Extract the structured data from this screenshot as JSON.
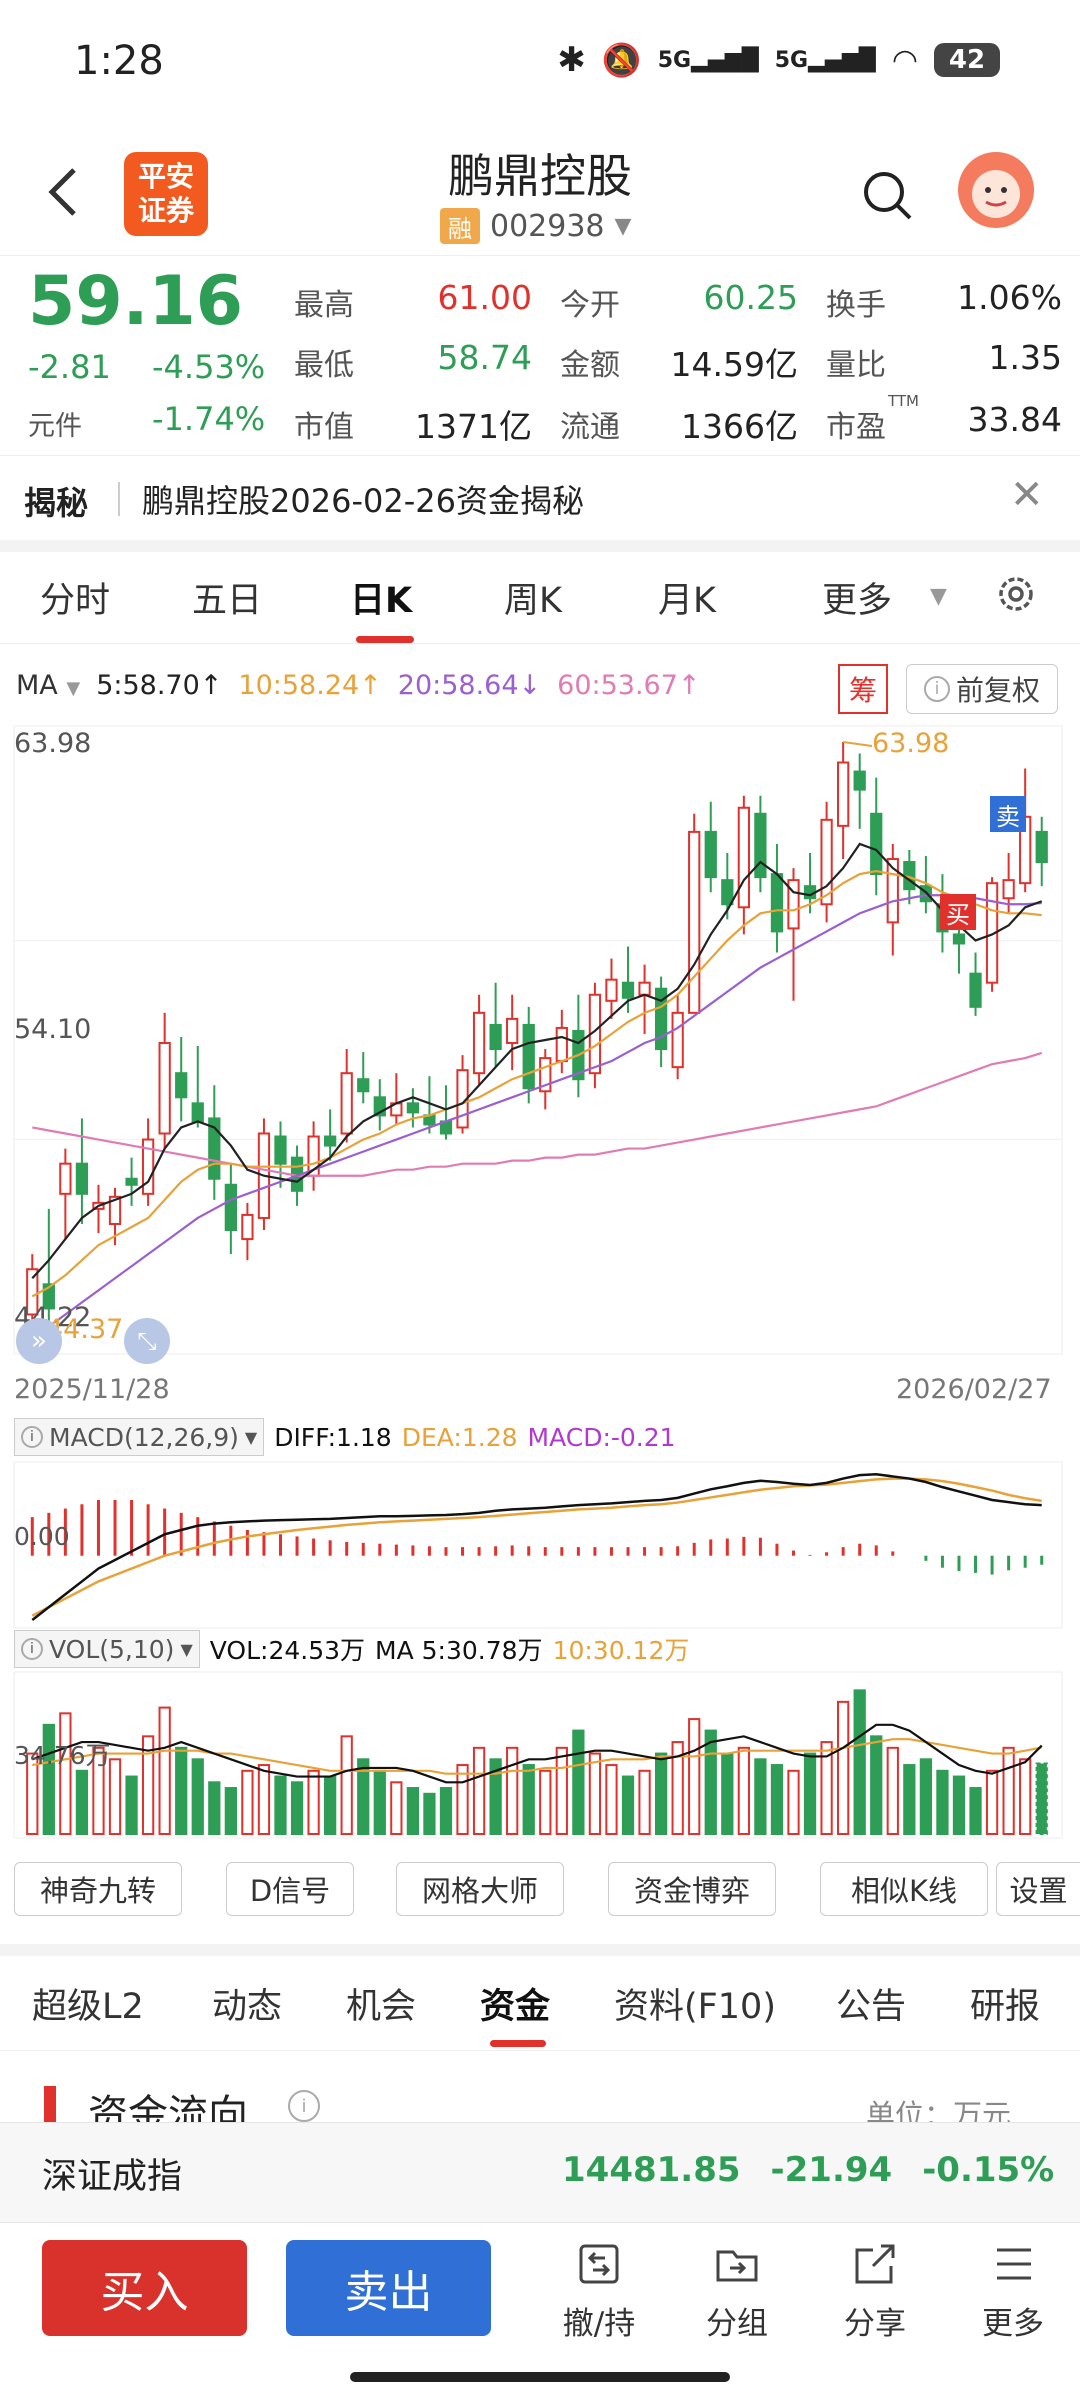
{
  "status": {
    "time": "1:28",
    "net1": "5G",
    "net2": "5G",
    "battery": "42"
  },
  "header": {
    "broker_logo": "平安\n证券",
    "stock_name": "鹏鼎控股",
    "rong_badge": "融",
    "stock_code": "002938"
  },
  "quote": {
    "price": "59.16",
    "change": "-2.81",
    "change_pct": "-4.53%",
    "unit_label": "元件",
    "sector_pct": "-1.74%",
    "fields": [
      {
        "label": "最高",
        "value": "61.00",
        "color": "#e0312c"
      },
      {
        "label": "最低",
        "value": "58.74",
        "color": "#2e9d55"
      },
      {
        "label": "市值",
        "value": "1371亿",
        "color": "#222222"
      },
      {
        "label": "今开",
        "value": "60.25",
        "color": "#2e9d55"
      },
      {
        "label": "金额",
        "value": "14.59亿",
        "color": "#222222"
      },
      {
        "label": "流通",
        "value": "1366亿",
        "color": "#222222"
      },
      {
        "label": "换手",
        "value": "1.06%",
        "color": "#222222"
      },
      {
        "label": "量比",
        "value": "1.35",
        "color": "#222222"
      },
      {
        "label": "市盈",
        "value": "33.84",
        "color": "#222222"
      }
    ],
    "ttm": "TTM"
  },
  "reveal": {
    "tag": "揭秘",
    "text": "鹏鼎控股2026-02-26资金揭秘"
  },
  "period_tabs": [
    "分时",
    "五日",
    "日K",
    "周K",
    "月K",
    "更多"
  ],
  "ma": {
    "label": "MA",
    "ma5": "5:58.70↑",
    "ma10": "10:58.24↑",
    "ma20": "20:58.64↓",
    "ma60": "60:53.67↑",
    "chip_label": "筹",
    "fq_label": "前复权"
  },
  "kline": {
    "y_top": "63.98",
    "y_mid": "54.10",
    "y_bottom": "44.22",
    "high_marker": "63.98",
    "low_marker": "44.37",
    "date_start": "2025/11/28",
    "date_end": "2026/02/27",
    "sell_tag": "卖",
    "buy_tag": "买"
  },
  "macd": {
    "label": "MACD(12,26,9)",
    "diff": "DIFF:1.18",
    "dea": "DEA:1.28",
    "macd": "MACD:-0.21",
    "axis": "0.00"
  },
  "vol": {
    "label": "VOL(5,10)",
    "vol": "VOL:24.53万",
    "ma5": "MA 5:30.78万",
    "ma10": "10:30.12万",
    "axis": "34.76万"
  },
  "tools": [
    "神奇九转",
    "D信号",
    "网格大师",
    "资金博弈",
    "相似K线",
    "设置"
  ],
  "section_tabs": [
    "超级L2",
    "动态",
    "机会",
    "资金",
    "资料(F10)",
    "公告",
    "研报"
  ],
  "flow": {
    "title": "资金流向",
    "unit": "单位：万元"
  },
  "index": {
    "name": "深证成指",
    "value": "14481.85",
    "change": "-21.94",
    "pct": "-0.15%"
  },
  "bottom": {
    "buy": "买入",
    "sell": "卖出",
    "items": [
      "撤/持",
      "分组",
      "分享",
      "更多"
    ]
  },
  "chart_data": {
    "type": "candlestick",
    "title": "",
    "x_range": [
      "2025/11/28",
      "2026/02/27"
    ],
    "ylim": [
      44.22,
      63.98
    ],
    "y_ticks": [
      63.98,
      54.1,
      44.22
    ],
    "candles": [
      {
        "o": 45.0,
        "h": 47.0,
        "l": 44.5,
        "c": 46.5
      },
      {
        "o": 46.0,
        "h": 48.5,
        "l": 44.4,
        "c": 45.2
      },
      {
        "o": 49.0,
        "h": 50.5,
        "l": 47.5,
        "c": 50.0
      },
      {
        "o": 50.0,
        "h": 51.5,
        "l": 48.0,
        "c": 49.0
      },
      {
        "o": 48.5,
        "h": 49.3,
        "l": 47.7,
        "c": 48.7
      },
      {
        "o": 48.0,
        "h": 49.2,
        "l": 47.3,
        "c": 48.9
      },
      {
        "o": 49.5,
        "h": 50.2,
        "l": 48.6,
        "c": 49.3
      },
      {
        "o": 49.0,
        "h": 51.5,
        "l": 48.6,
        "c": 50.8
      },
      {
        "o": 51.0,
        "h": 55.0,
        "l": 50.5,
        "c": 54.0
      },
      {
        "o": 53.0,
        "h": 54.2,
        "l": 51.4,
        "c": 52.2
      },
      {
        "o": 52.0,
        "h": 53.9,
        "l": 51.2,
        "c": 51.4
      },
      {
        "o": 51.5,
        "h": 52.6,
        "l": 48.8,
        "c": 49.5
      },
      {
        "o": 49.3,
        "h": 50.0,
        "l": 47.0,
        "c": 47.8
      },
      {
        "o": 47.5,
        "h": 48.7,
        "l": 46.8,
        "c": 48.3
      },
      {
        "o": 48.2,
        "h": 51.5,
        "l": 47.8,
        "c": 51.0
      },
      {
        "o": 50.9,
        "h": 51.4,
        "l": 49.2,
        "c": 50.0
      },
      {
        "o": 50.2,
        "h": 50.6,
        "l": 48.6,
        "c": 49.1
      },
      {
        "o": 49.6,
        "h": 51.4,
        "l": 49.1,
        "c": 50.9
      },
      {
        "o": 50.9,
        "h": 51.8,
        "l": 50.1,
        "c": 50.6
      },
      {
        "o": 51.0,
        "h": 53.8,
        "l": 50.7,
        "c": 53.0
      },
      {
        "o": 52.8,
        "h": 53.7,
        "l": 52.0,
        "c": 52.4
      },
      {
        "o": 52.2,
        "h": 52.8,
        "l": 51.1,
        "c": 51.6
      },
      {
        "o": 51.6,
        "h": 53.0,
        "l": 51.3,
        "c": 52.0
      },
      {
        "o": 52.0,
        "h": 52.5,
        "l": 51.2,
        "c": 51.7
      },
      {
        "o": 51.6,
        "h": 52.9,
        "l": 51.0,
        "c": 51.3
      },
      {
        "o": 51.4,
        "h": 52.6,
        "l": 50.8,
        "c": 51.0
      },
      {
        "o": 51.2,
        "h": 53.6,
        "l": 51.0,
        "c": 53.1
      },
      {
        "o": 53.0,
        "h": 55.6,
        "l": 52.6,
        "c": 55.0
      },
      {
        "o": 54.6,
        "h": 56.0,
        "l": 53.2,
        "c": 53.8
      },
      {
        "o": 54.0,
        "h": 55.6,
        "l": 53.1,
        "c": 54.8
      },
      {
        "o": 54.6,
        "h": 55.2,
        "l": 52.0,
        "c": 52.5
      },
      {
        "o": 52.4,
        "h": 53.8,
        "l": 51.8,
        "c": 53.5
      },
      {
        "o": 53.4,
        "h": 55.1,
        "l": 53.0,
        "c": 54.5
      },
      {
        "o": 54.4,
        "h": 55.6,
        "l": 52.2,
        "c": 52.8
      },
      {
        "o": 53.0,
        "h": 56.0,
        "l": 52.5,
        "c": 55.6
      },
      {
        "o": 55.4,
        "h": 56.8,
        "l": 54.8,
        "c": 56.1
      },
      {
        "o": 56.0,
        "h": 57.2,
        "l": 55.0,
        "c": 55.5
      },
      {
        "o": 55.6,
        "h": 56.6,
        "l": 54.3,
        "c": 56.0
      },
      {
        "o": 55.8,
        "h": 56.2,
        "l": 53.2,
        "c": 53.8
      },
      {
        "o": 53.2,
        "h": 55.6,
        "l": 52.8,
        "c": 55.0
      },
      {
        "o": 55.0,
        "h": 61.6,
        "l": 55.0,
        "c": 61.0
      },
      {
        "o": 61.0,
        "h": 62.0,
        "l": 59.0,
        "c": 59.5
      },
      {
        "o": 59.4,
        "h": 60.3,
        "l": 58.1,
        "c": 58.6
      },
      {
        "o": 58.5,
        "h": 62.2,
        "l": 57.6,
        "c": 61.8
      },
      {
        "o": 61.6,
        "h": 62.2,
        "l": 59.0,
        "c": 59.5
      },
      {
        "o": 59.6,
        "h": 60.6,
        "l": 57.0,
        "c": 57.7
      },
      {
        "o": 57.8,
        "h": 59.8,
        "l": 55.4,
        "c": 59.4
      },
      {
        "o": 59.2,
        "h": 60.3,
        "l": 58.3,
        "c": 58.8
      },
      {
        "o": 58.6,
        "h": 62.0,
        "l": 58.0,
        "c": 61.4
      },
      {
        "o": 61.2,
        "h": 63.98,
        "l": 60.1,
        "c": 63.3
      },
      {
        "o": 63.0,
        "h": 63.6,
        "l": 61.1,
        "c": 62.4
      },
      {
        "o": 61.6,
        "h": 62.8,
        "l": 58.9,
        "c": 59.6
      },
      {
        "o": 58.0,
        "h": 60.6,
        "l": 56.9,
        "c": 60.1
      },
      {
        "o": 60.0,
        "h": 60.4,
        "l": 58.6,
        "c": 59.1
      },
      {
        "o": 59.2,
        "h": 60.2,
        "l": 58.3,
        "c": 58.7
      },
      {
        "o": 58.6,
        "h": 59.6,
        "l": 57.0,
        "c": 57.7
      },
      {
        "o": 57.6,
        "h": 58.4,
        "l": 56.3,
        "c": 57.3
      },
      {
        "o": 56.3,
        "h": 57.0,
        "l": 54.9,
        "c": 55.2
      },
      {
        "o": 56.0,
        "h": 59.5,
        "l": 55.7,
        "c": 59.3
      },
      {
        "o": 58.8,
        "h": 60.3,
        "l": 58.3,
        "c": 59.4
      },
      {
        "o": 59.3,
        "h": 63.1,
        "l": 59.0,
        "c": 61.5
      },
      {
        "o": 61.0,
        "h": 61.5,
        "l": 59.2,
        "c": 60.0
      }
    ],
    "ma5": [
      46.2,
      46.8,
      47.5,
      48.2,
      48.6,
      48.8,
      49.0,
      49.4,
      50.5,
      51.2,
      51.4,
      51.2,
      50.6,
      49.8,
      49.6,
      49.5,
      49.4,
      49.8,
      50.2,
      50.9,
      51.4,
      51.7,
      52.0,
      52.2,
      52.0,
      51.8,
      52.0,
      52.6,
      53.2,
      53.8,
      54.0,
      54.1,
      54.2,
      54.0,
      54.4,
      54.9,
      55.4,
      55.6,
      55.4,
      55.8,
      56.6,
      57.6,
      58.4,
      59.4,
      60.0,
      59.6,
      59.0,
      58.9,
      59.2,
      59.8,
      60.6,
      60.4,
      59.8,
      59.4,
      59.0,
      58.4,
      57.9,
      57.4,
      57.6,
      57.9,
      58.5,
      58.7
    ],
    "ma10": [
      45.6,
      45.9,
      46.3,
      46.8,
      47.3,
      47.6,
      47.9,
      48.2,
      48.8,
      49.4,
      49.8,
      50.0,
      50.0,
      49.9,
      49.9,
      49.9,
      49.9,
      50.0,
      50.2,
      50.5,
      50.8,
      51.0,
      51.3,
      51.5,
      51.6,
      51.8,
      52.0,
      52.2,
      52.5,
      52.8,
      53.0,
      53.2,
      53.4,
      53.6,
      53.9,
      54.3,
      54.7,
      55.0,
      55.2,
      55.6,
      56.2,
      56.8,
      57.4,
      57.9,
      58.3,
      58.4,
      58.4,
      58.6,
      58.9,
      59.3,
      59.6,
      59.7,
      59.6,
      59.5,
      59.3,
      59.0,
      58.8,
      58.6,
      58.4,
      58.3,
      58.3,
      58.24
    ],
    "ma20": [
      44.2,
      44.6,
      45.0,
      45.4,
      45.8,
      46.2,
      46.6,
      47.0,
      47.4,
      47.8,
      48.2,
      48.5,
      48.8,
      49.0,
      49.2,
      49.4,
      49.6,
      49.8,
      50.0,
      50.2,
      50.4,
      50.6,
      50.8,
      51.0,
      51.2,
      51.4,
      51.6,
      51.8,
      52.0,
      52.2,
      52.4,
      52.6,
      52.8,
      53.0,
      53.2,
      53.4,
      53.7,
      54.0,
      54.2,
      54.5,
      54.9,
      55.3,
      55.7,
      56.1,
      56.5,
      56.8,
      57.1,
      57.4,
      57.7,
      58.0,
      58.3,
      58.5,
      58.7,
      58.8,
      58.9,
      58.9,
      58.9,
      58.8,
      58.7,
      58.6,
      58.6,
      58.64
    ],
    "ma60": [
      51.2,
      51.1,
      51.0,
      50.9,
      50.8,
      50.7,
      50.6,
      50.5,
      50.4,
      50.3,
      50.2,
      50.1,
      50.0,
      49.9,
      49.8,
      49.7,
      49.6,
      49.6,
      49.6,
      49.6,
      49.6,
      49.7,
      49.8,
      49.8,
      49.9,
      49.9,
      50.0,
      50.0,
      50.0,
      50.1,
      50.1,
      50.2,
      50.2,
      50.3,
      50.3,
      50.4,
      50.5,
      50.5,
      50.6,
      50.7,
      50.8,
      50.9,
      51.0,
      51.1,
      51.2,
      51.3,
      51.4,
      51.5,
      51.6,
      51.7,
      51.8,
      51.9,
      52.1,
      52.3,
      52.5,
      52.7,
      52.9,
      53.1,
      53.3,
      53.4,
      53.5,
      53.67
    ],
    "macd_range": [
      -1.5,
      2.0
    ],
    "diff": [
      -1.5,
      -1.2,
      -0.9,
      -0.6,
      -0.3,
      -0.1,
      0.1,
      0.3,
      0.5,
      0.6,
      0.7,
      0.75,
      0.78,
      0.8,
      0.82,
      0.83,
      0.84,
      0.85,
      0.86,
      0.88,
      0.9,
      0.92,
      0.92,
      0.93,
      0.94,
      0.95,
      0.97,
      1.0,
      1.05,
      1.08,
      1.1,
      1.12,
      1.15,
      1.18,
      1.2,
      1.22,
      1.25,
      1.28,
      1.3,
      1.35,
      1.45,
      1.55,
      1.62,
      1.7,
      1.75,
      1.72,
      1.68,
      1.65,
      1.7,
      1.8,
      1.88,
      1.9,
      1.85,
      1.8,
      1.72,
      1.6,
      1.5,
      1.4,
      1.3,
      1.25,
      1.2,
      1.18
    ],
    "dea": [
      -1.4,
      -1.2,
      -1.0,
      -0.8,
      -0.6,
      -0.45,
      -0.3,
      -0.15,
      0.0,
      0.1,
      0.2,
      0.3,
      0.38,
      0.45,
      0.5,
      0.55,
      0.6,
      0.64,
      0.68,
      0.72,
      0.75,
      0.78,
      0.8,
      0.82,
      0.84,
      0.86,
      0.88,
      0.9,
      0.93,
      0.96,
      0.99,
      1.02,
      1.05,
      1.08,
      1.1,
      1.12,
      1.15,
      1.18,
      1.2,
      1.24,
      1.3,
      1.36,
      1.42,
      1.48,
      1.54,
      1.58,
      1.62,
      1.64,
      1.66,
      1.7,
      1.74,
      1.78,
      1.8,
      1.8,
      1.78,
      1.74,
      1.68,
      1.6,
      1.52,
      1.42,
      1.34,
      1.28
    ],
    "macd_bars": [
      0.9,
      1.0,
      1.1,
      1.2,
      1.3,
      1.3,
      1.3,
      1.2,
      1.1,
      1.0,
      0.9,
      0.8,
      0.7,
      0.6,
      0.55,
      0.5,
      0.45,
      0.4,
      0.36,
      0.32,
      0.3,
      0.28,
      0.26,
      0.24,
      0.22,
      0.2,
      0.2,
      0.2,
      0.22,
      0.24,
      0.22,
      0.2,
      0.2,
      0.2,
      0.2,
      0.2,
      0.2,
      0.2,
      0.2,
      0.22,
      0.3,
      0.38,
      0.4,
      0.44,
      0.42,
      0.28,
      0.12,
      0.02,
      0.08,
      0.2,
      0.28,
      0.24,
      0.1,
      0.0,
      -0.12,
      -0.28,
      -0.36,
      -0.4,
      -0.44,
      -0.34,
      -0.28,
      -0.21
    ],
    "volumes": [
      28,
      38,
      42,
      22,
      30,
      26,
      20,
      34,
      44,
      30,
      26,
      18,
      16,
      22,
      24,
      20,
      18,
      22,
      20,
      34,
      26,
      22,
      18,
      16,
      14,
      16,
      24,
      30,
      26,
      30,
      24,
      22,
      30,
      36,
      28,
      24,
      20,
      22,
      28,
      32,
      40,
      36,
      28,
      30,
      26,
      24,
      22,
      28,
      32,
      46,
      50,
      34,
      30,
      24,
      26,
      22,
      20,
      16,
      22,
      30,
      26,
      24.53
    ],
    "vol_ma5": [
      26,
      28,
      30,
      32,
      32,
      31,
      30,
      29,
      30,
      32,
      30,
      28,
      26,
      24,
      22,
      21,
      20,
      20,
      20,
      22,
      23,
      23,
      23,
      22,
      20,
      18,
      18,
      20,
      22,
      24,
      26,
      26,
      27,
      28,
      29,
      29,
      28,
      27,
      26,
      27,
      29,
      32,
      33,
      34,
      32,
      30,
      28,
      27,
      27,
      30,
      34,
      38,
      38,
      36,
      32,
      28,
      24,
      22,
      21,
      23,
      25,
      30.78
    ],
    "vol_ma10": [
      24,
      25,
      26,
      27,
      28,
      28,
      28,
      28,
      29,
      29,
      29,
      28,
      28,
      27,
      26,
      25,
      24,
      23,
      22,
      22,
      22,
      22,
      22,
      22,
      22,
      21,
      21,
      21,
      21,
      22,
      22,
      23,
      23,
      24,
      25,
      26,
      26,
      26,
      27,
      27,
      27,
      28,
      28,
      29,
      29,
      29,
      29,
      29,
      29,
      30,
      31,
      32,
      33,
      33,
      32,
      31,
      30,
      29,
      28,
      28,
      29,
      30.12
    ],
    "vol_range": [
      0,
      55
    ]
  }
}
